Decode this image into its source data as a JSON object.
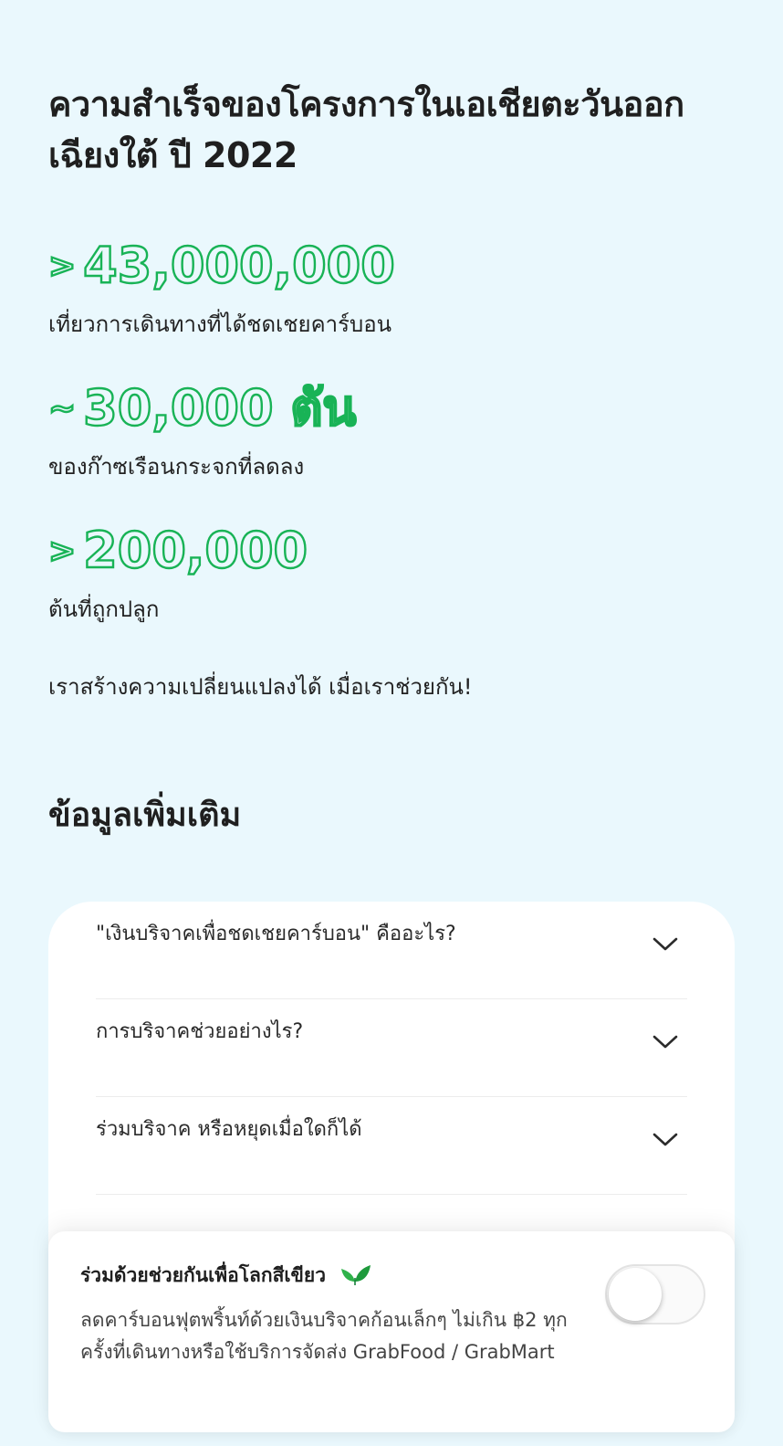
{
  "hero": {
    "title": "ความสำเร็จของโครงการในเอเชียตะวันออกเฉียงใต้ ปี 2022"
  },
  "stats": [
    {
      "prefix": ">",
      "value": "43,000,000",
      "label": "เที่ยวการเดินทางที่ได้ชดเชยคาร์บอน"
    },
    {
      "prefix": "~",
      "value": "30,000 ตัน",
      "label": "ของก๊าซเรือนกระจกที่ลดลง"
    },
    {
      "prefix": ">",
      "value": "200,000",
      "label": "ต้นที่ถูกปลูก"
    }
  ],
  "tagline": "เราสร้างความเปลี่ยนแปลงได้ เมื่อเราช่วยกัน!",
  "more_info": {
    "title": "ข้อมูลเพิ่มเติม",
    "faqs": [
      {
        "question": "\"เงินบริจาคเพื่อชดเชยคาร์บอน\" คืออะไร?",
        "icon": "chevron-down-icon"
      },
      {
        "question": "การบริจาคช่วยอย่างไร?",
        "icon": "chevron-down-icon"
      },
      {
        "question": "ร่วมบริจาค หรือหยุดเมื่อใดก็ได้",
        "icon": "chevron-down-icon"
      },
      {
        "question": "",
        "icon": "chevron-down-icon"
      }
    ]
  },
  "donation_banner": {
    "title": "ร่วมด้วยช่วยกันเพื่อโลกสีเขียว",
    "icon": "leaf-icon",
    "description": "ลดคาร์บอนฟุตพริ้นท์ด้วยเงินบริจาคก้อนเล็กๆ ไม่เกิน ฿2 ทุกครั้งที่เดินทางหรือใช้บริการจัดส่ง GrabFood / GrabMart",
    "toggle_on": false
  },
  "colors": {
    "background": "#eaf8fd",
    "accent_green": "#18b356",
    "card": "#ffffff"
  }
}
